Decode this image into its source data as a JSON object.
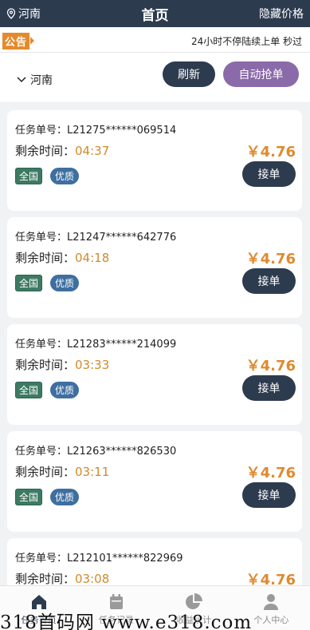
{
  "header": {
    "location": "河南",
    "title": "首页",
    "hide_price": "隐藏价格"
  },
  "notice": {
    "badge": "公告",
    "text": "24小时不停陆续上单 秒过"
  },
  "filter": {
    "region": "河南",
    "refresh": "刷新",
    "auto_grab": "自动抢单"
  },
  "orders": [
    {
      "label": "任务单号：",
      "id": "L21275******069514",
      "time_label": "剩余时间：",
      "time": "04:37",
      "price": "￥4.76",
      "tag1": "全国",
      "tag2": "优质",
      "accept": "接单"
    },
    {
      "label": "任务单号：",
      "id": "L21247******642776",
      "time_label": "剩余时间：",
      "time": "04:18",
      "price": "￥4.76",
      "tag1": "全国",
      "tag2": "优质",
      "accept": "接单"
    },
    {
      "label": "任务单号：",
      "id": "L21283******214099",
      "time_label": "剩余时间：",
      "time": "03:33",
      "price": "￥4.76",
      "tag1": "全国",
      "tag2": "优质",
      "accept": "接单"
    },
    {
      "label": "任务单号：",
      "id": "L21263******826530",
      "time_label": "剩余时间：",
      "time": "03:11",
      "price": "￥4.76",
      "tag1": "全国",
      "tag2": "优质",
      "accept": "接单"
    },
    {
      "label": "任务单号：",
      "id": "L212101******822969",
      "time_label": "剩余时间：",
      "time": "03:08",
      "price": "￥4.76"
    }
  ],
  "tabs": [
    {
      "label": "任务首页",
      "icon": "home-icon"
    },
    {
      "label": "任务记录",
      "icon": "calendar-icon"
    },
    {
      "label": "收益统计",
      "icon": "pie-chart-icon"
    },
    {
      "label": "个人中心",
      "icon": "user-icon"
    }
  ],
  "watermark": "318首码网 www.e318.com",
  "colors": {
    "header_bg": "#2d3b4f",
    "accent_orange": "#e08a2e",
    "auto_button": "#8a6aa8",
    "tag_green": "#3e7a63",
    "tag_blue": "#3e6fa0"
  }
}
